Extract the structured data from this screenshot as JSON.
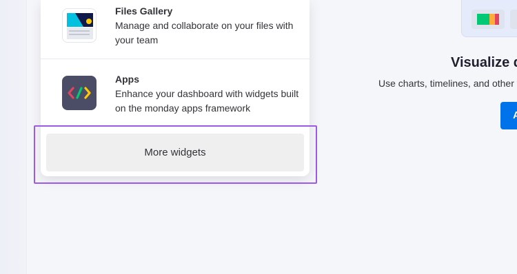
{
  "widgets_menu": {
    "items": [
      {
        "title": "Files Gallery",
        "description": "Manage and collaborate on your files with your team",
        "icon": "files-gallery-icon"
      },
      {
        "title": "Apps",
        "description": "Enhance your dashboard with widgets built on the monday apps framework",
        "icon": "apps-code-icon"
      }
    ],
    "more_button_label": "More widgets"
  },
  "promo": {
    "title": "Visualize d",
    "subtitle": "Use charts, timelines, and other v",
    "button_label": "A"
  },
  "colors": {
    "accent_purple": "#9b59e8",
    "primary_blue": "#0073ea",
    "apps_icon_bg": "#4b4c66"
  }
}
